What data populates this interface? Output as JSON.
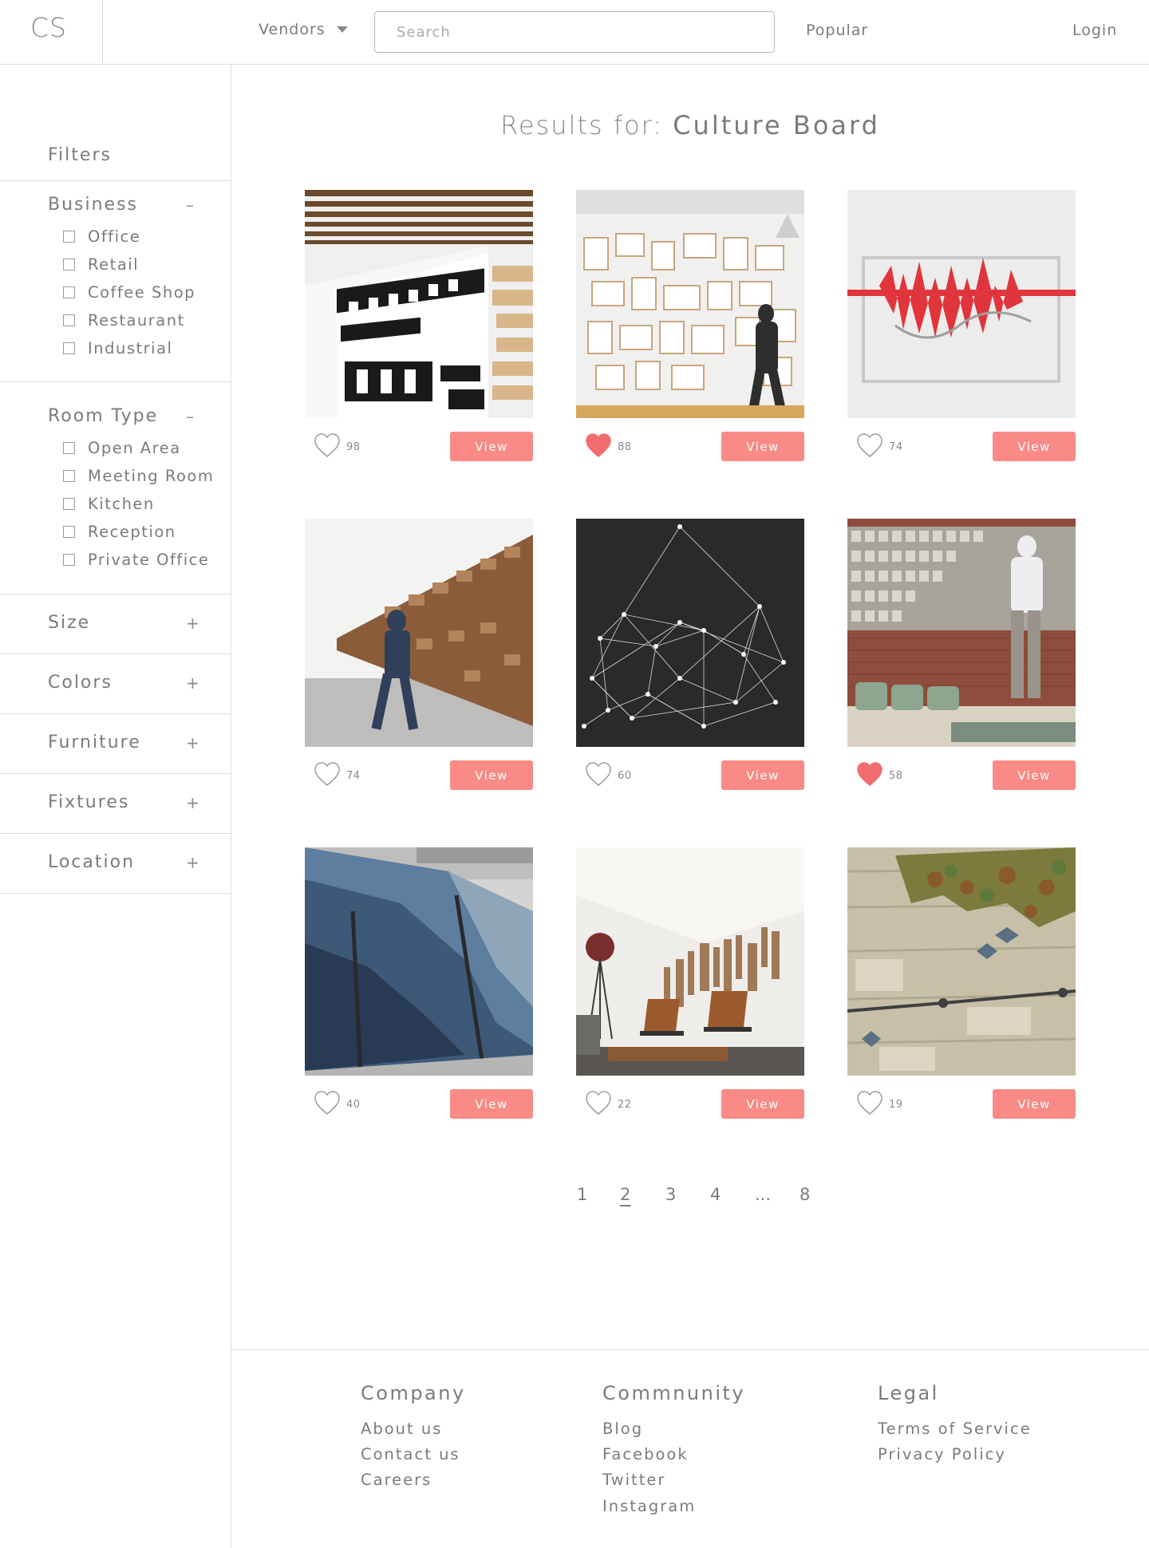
{
  "header": {
    "logo": "CS",
    "vendors_label": "Vendors",
    "search_placeholder": "Search",
    "popular_label": "Popular",
    "login_label": "Login"
  },
  "sidebar": {
    "title": "Filters",
    "sections": [
      {
        "label": "Business",
        "toggle": "–",
        "options": [
          "Office",
          "Retail",
          "Coffee Shop",
          "Restaurant",
          "Industrial"
        ]
      },
      {
        "label": "Room Type",
        "toggle": "–",
        "options": [
          "Open Area",
          "Meeting Room",
          "Kitchen",
          "Reception",
          "Private Office"
        ]
      },
      {
        "label": "Size",
        "toggle": "+"
      },
      {
        "label": "Colors",
        "toggle": "+"
      },
      {
        "label": "Furniture",
        "toggle": "+"
      },
      {
        "label": "Fixtures",
        "toggle": "+"
      },
      {
        "label": "Location",
        "toggle": "+"
      }
    ]
  },
  "results": {
    "prefix": "Results for:",
    "query": "Culture Board"
  },
  "cards": [
    {
      "likes": "98",
      "liked": false,
      "view_label": "View"
    },
    {
      "likes": "88",
      "liked": true,
      "view_label": "View"
    },
    {
      "likes": "74",
      "liked": false,
      "view_label": "View"
    },
    {
      "likes": "74",
      "liked": false,
      "view_label": "View"
    },
    {
      "likes": "60",
      "liked": false,
      "view_label": "View"
    },
    {
      "likes": "58",
      "liked": true,
      "view_label": "View"
    },
    {
      "likes": "40",
      "liked": false,
      "view_label": "View"
    },
    {
      "likes": "22",
      "liked": false,
      "view_label": "View"
    },
    {
      "likes": "19",
      "liked": false,
      "view_label": "View"
    }
  ],
  "pagination": {
    "pages": [
      "1",
      "2",
      "3",
      "4",
      "...",
      "8"
    ],
    "current": "2"
  },
  "footer": {
    "company": {
      "title": "Company",
      "links": [
        "About us",
        "Contact us",
        "Careers"
      ]
    },
    "community": {
      "title": "Commnunity",
      "links": [
        "Blog",
        "Facebook",
        "Twitter",
        "Instagram"
      ]
    },
    "legal": {
      "title": "Legal",
      "links": [
        "Terms of Service",
        "Privacy Policy"
      ]
    }
  },
  "colors": {
    "accent": "#f98a85",
    "heart_filled": "#f26d70",
    "text": "#7b7b7b",
    "divider": "#dcdcdc"
  }
}
